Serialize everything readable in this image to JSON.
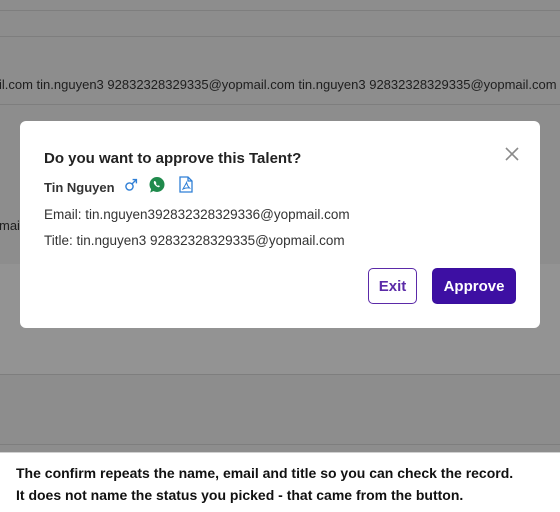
{
  "background": {
    "row1_text": "il.com tin.nguyen3 92832328329335@yopmail.com tin.nguyen3 92832328329335@yopmail.com tin.n",
    "row2_text": "mai"
  },
  "dialog": {
    "title": "Do you want to approve this Talent?",
    "name": "Tin Nguyen",
    "gender_icon": "male-icon",
    "whatsapp_icon": "whatsapp-icon",
    "pdf_icon": "pdf-file-icon",
    "email_line": "Email: tin.nguyen392832328329336@yopmail.com",
    "title_line": "Title: tin.nguyen3 92832328329335@yopmail.com",
    "exit_label": "Exit",
    "approve_label": "Approve"
  },
  "caption": {
    "line1": "The confirm repeats the name, email and title so you can check the record.",
    "line2": "It does not name the status you picked - that came from the button."
  },
  "colors": {
    "primary": "#3d0fa3",
    "accent_blue": "#2f7fd6",
    "whatsapp_green": "#1f8a4c",
    "overlay": "#8d8d8d"
  }
}
